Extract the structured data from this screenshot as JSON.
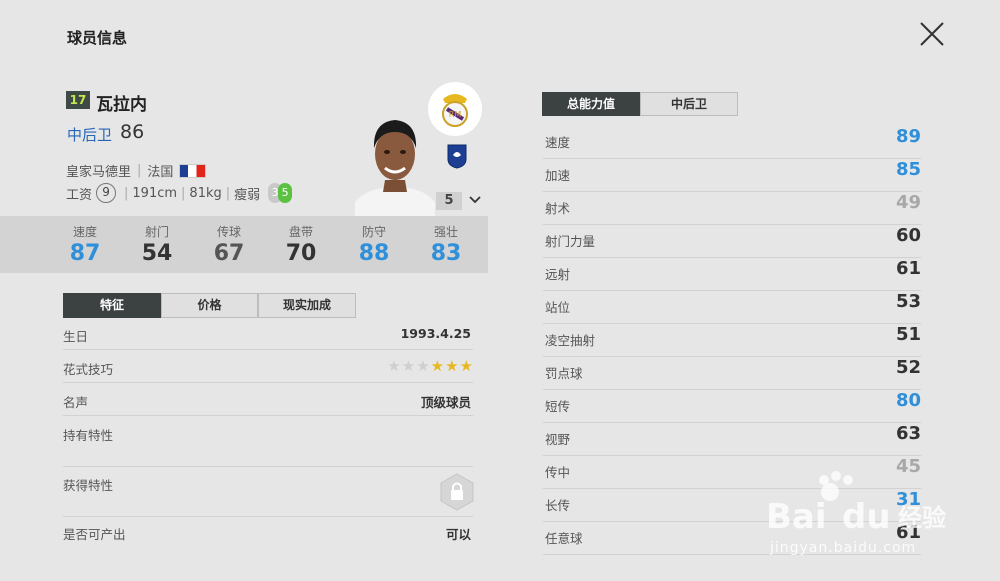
{
  "header": {
    "title": "球员信息"
  },
  "player": {
    "ovr_badge": "17",
    "name": "瓦拉内",
    "position": "中后卫",
    "position_ovr": "86",
    "club": "皇家马德里",
    "nation": "法国",
    "wage_label": "工资",
    "wage": "9",
    "height": "191cm",
    "weight": "81kg",
    "body_type": "瘦弱",
    "weak_foot": "3",
    "skill": "5",
    "level": "5"
  },
  "stats": [
    {
      "label": "速度",
      "value": "87",
      "color": "#2f8fd8"
    },
    {
      "label": "射门",
      "value": "54",
      "color": "#333333"
    },
    {
      "label": "传球",
      "value": "67",
      "color": "#555555"
    },
    {
      "label": "盘带",
      "value": "70",
      "color": "#333333"
    },
    {
      "label": "防守",
      "value": "88",
      "color": "#2f8fd8"
    },
    {
      "label": "强壮",
      "value": "83",
      "color": "#2f8fd8"
    }
  ],
  "left_tabs": [
    "特征",
    "价格",
    "现实加成"
  ],
  "info": {
    "birthday_label": "生日",
    "birthday": "1993.4.25",
    "skill_moves_label": "花式技巧",
    "skill_stars": 3,
    "skill_stars_max": 6,
    "fame_label": "名声",
    "fame": "顶级球员",
    "traits_label": "持有特性",
    "acquired_label": "获得特性",
    "producible_label": "是否可产出",
    "producible": "可以"
  },
  "right_tabs": [
    "总能力值",
    "中后卫"
  ],
  "attributes": [
    {
      "label": "速度",
      "value": "89",
      "tone": "blue"
    },
    {
      "label": "加速",
      "value": "85",
      "tone": "blue"
    },
    {
      "label": "射术",
      "value": "49",
      "tone": "gray"
    },
    {
      "label": "射门力量",
      "value": "60",
      "tone": "dark"
    },
    {
      "label": "远射",
      "value": "61",
      "tone": "dark"
    },
    {
      "label": "站位",
      "value": "53",
      "tone": "dark"
    },
    {
      "label": "凌空抽射",
      "value": "51",
      "tone": "dark"
    },
    {
      "label": "罚点球",
      "value": "52",
      "tone": "dark"
    },
    {
      "label": "短传",
      "value": "80",
      "tone": "blue"
    },
    {
      "label": "视野",
      "value": "63",
      "tone": "dark"
    },
    {
      "label": "传中",
      "value": "45",
      "tone": "gray"
    },
    {
      "label": "长传",
      "value": "31",
      "tone": "blue"
    },
    {
      "label": "任意球",
      "value": "61",
      "tone": "dark"
    }
  ],
  "watermark": {
    "text": "jingyan.baidu.com"
  }
}
